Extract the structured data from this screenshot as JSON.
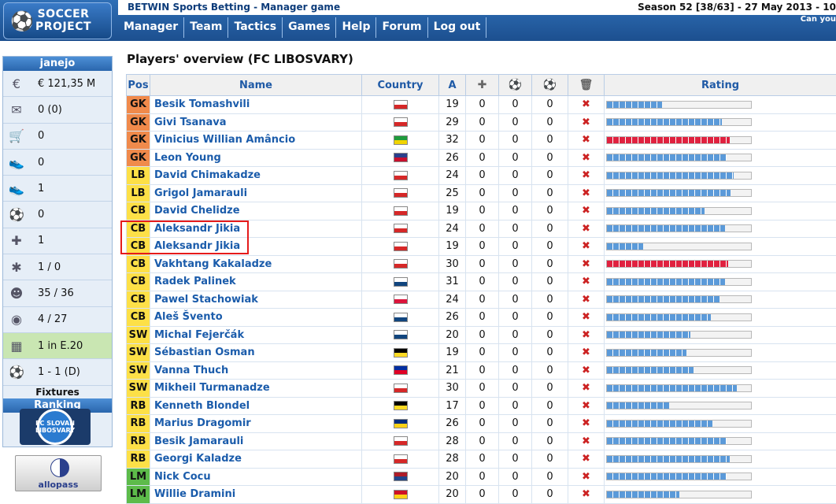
{
  "header": {
    "logo_line1": "SOCCER",
    "logo_line2": "PROJECT",
    "betwin": "BETWIN Sports Betting - Manager game",
    "season": "Season 52 [38/63] - 27 May 2013 - 10",
    "can_you": "Can you"
  },
  "nav": [
    "Manager",
    "Team",
    "Tactics",
    "Games",
    "Help",
    "Forum",
    "Log out"
  ],
  "sidebar": {
    "username": "janejo",
    "items": [
      {
        "icon": "money-icon",
        "value": "€ 121,35 M"
      },
      {
        "icon": "mail-icon",
        "value": "0 (0)"
      },
      {
        "icon": "cart-icon",
        "value": "0"
      },
      {
        "icon": "shoes-icon",
        "value": "0"
      },
      {
        "icon": "shoe-icon",
        "value": "1"
      },
      {
        "icon": "shoe-ball-icon",
        "value": "0"
      },
      {
        "icon": "medical-cross-icon",
        "value": "1"
      },
      {
        "icon": "injury-icon",
        "value": "1 / 0"
      },
      {
        "icon": "players-icon",
        "value": "35 / 36"
      },
      {
        "icon": "whistle-icon",
        "value": "4 / 27"
      },
      {
        "icon": "stadium-icon",
        "value": "1 in E.20"
      },
      {
        "icon": "ball-icon",
        "value": "1 - 1 (D)"
      }
    ],
    "fixtures": "Fixtures",
    "ranking": "Ranking",
    "crest_text": "FC SLOVAN LIBOSVARY",
    "allopass": "allopass"
  },
  "main": {
    "title": "Players' overview (FC LIBOSVARY)",
    "columns": [
      "Pos",
      "Name",
      "Country",
      "A",
      "",
      "",
      "",
      "",
      "Rating"
    ],
    "colors": {
      "GK": "#f08a4b",
      "LB": "#fde047",
      "CB": "#fde047",
      "SW": "#fde047",
      "RB": "#fde047",
      "LM": "#5dbb4a"
    },
    "players": [
      {
        "pos": "GK",
        "name": "Besik Tomashvili",
        "flag": "#ffffff",
        "flag2": "#d62828",
        "age": "19",
        "c1": "0",
        "c2": "0",
        "c3": "0",
        "rating": 0.38,
        "red": false
      },
      {
        "pos": "GK",
        "name": "Givi Tsanava",
        "flag": "#ffffff",
        "flag2": "#d62828",
        "age": "29",
        "c1": "0",
        "c2": "0",
        "c3": "0",
        "rating": 0.8,
        "red": false
      },
      {
        "pos": "GK",
        "name": "Vinicius Willian Amâncio",
        "flag": "#1e9b3c",
        "flag2": "#f1d400",
        "age": "32",
        "c1": "0",
        "c2": "0",
        "c3": "0",
        "rating": 0.85,
        "red": true
      },
      {
        "pos": "GK",
        "name": "Leon Young",
        "flag": "#2a3f8c",
        "flag2": "#c8102e",
        "age": "26",
        "c1": "0",
        "c2": "0",
        "c3": "0",
        "rating": 0.83,
        "red": false
      },
      {
        "pos": "LB",
        "name": "David Chimakadze",
        "flag": "#ffffff",
        "flag2": "#d62828",
        "age": "24",
        "c1": "0",
        "c2": "0",
        "c3": "0",
        "rating": 0.88,
        "red": false
      },
      {
        "pos": "LB",
        "name": "Grigol Jamarauli",
        "flag": "#ffffff",
        "flag2": "#d62828",
        "age": "25",
        "c1": "0",
        "c2": "0",
        "c3": "0",
        "rating": 0.86,
        "red": false
      },
      {
        "pos": "CB",
        "name": "David Chelidze",
        "flag": "#ffffff",
        "flag2": "#d62828",
        "age": "19",
        "c1": "0",
        "c2": "0",
        "c3": "0",
        "rating": 0.68,
        "red": false
      },
      {
        "pos": "CB",
        "name": "Aleksandr Jikia",
        "flag": "#ffffff",
        "flag2": "#d62828",
        "age": "24",
        "c1": "0",
        "c2": "0",
        "c3": "0",
        "rating": 0.82,
        "red": false
      },
      {
        "pos": "CB",
        "name": "Aleksandr Jikia",
        "flag": "#ffffff",
        "flag2": "#d62828",
        "age": "19",
        "c1": "0",
        "c2": "0",
        "c3": "0",
        "rating": 0.25,
        "red": false
      },
      {
        "pos": "CB",
        "name": "Vakhtang Kakaladze",
        "flag": "#ffffff",
        "flag2": "#d62828",
        "age": "30",
        "c1": "0",
        "c2": "0",
        "c3": "0",
        "rating": 0.84,
        "red": true
      },
      {
        "pos": "CB",
        "name": "Radek Palinek",
        "flag": "#ffffff",
        "flag2": "#11457e",
        "age": "31",
        "c1": "0",
        "c2": "0",
        "c3": "0",
        "rating": 0.82,
        "red": false
      },
      {
        "pos": "CB",
        "name": "Pawel Stachowiak",
        "flag": "#ffffff",
        "flag2": "#dc143c",
        "age": "24",
        "c1": "0",
        "c2": "0",
        "c3": "0",
        "rating": 0.78,
        "red": false
      },
      {
        "pos": "CB",
        "name": "Aleš Švento",
        "flag": "#ffffff",
        "flag2": "#11457e",
        "age": "26",
        "c1": "0",
        "c2": "0",
        "c3": "0",
        "rating": 0.72,
        "red": false
      },
      {
        "pos": "SW",
        "name": "Michal Fejerčák",
        "flag": "#ffffff",
        "flag2": "#11457e",
        "age": "20",
        "c1": "0",
        "c2": "0",
        "c3": "0",
        "rating": 0.58,
        "red": false
      },
      {
        "pos": "SW",
        "name": "Sébastian Osman",
        "flag": "#000000",
        "flag2": "#fdda24",
        "age": "19",
        "c1": "0",
        "c2": "0",
        "c3": "0",
        "rating": 0.55,
        "red": false
      },
      {
        "pos": "SW",
        "name": "Vanna Thuch",
        "flag": "#032ea1",
        "flag2": "#e00025",
        "age": "21",
        "c1": "0",
        "c2": "0",
        "c3": "0",
        "rating": 0.6,
        "red": false
      },
      {
        "pos": "SW",
        "name": "Mikheil Turmanadze",
        "flag": "#ffffff",
        "flag2": "#d62828",
        "age": "30",
        "c1": "0",
        "c2": "0",
        "c3": "0",
        "rating": 0.9,
        "red": false
      },
      {
        "pos": "RB",
        "name": "Kenneth Blondel",
        "flag": "#000000",
        "flag2": "#fdda24",
        "age": "17",
        "c1": "0",
        "c2": "0",
        "c3": "0",
        "rating": 0.43,
        "red": false
      },
      {
        "pos": "RB",
        "name": "Marius Dragomir",
        "flag": "#002b7f",
        "flag2": "#fcd116",
        "age": "26",
        "c1": "0",
        "c2": "0",
        "c3": "0",
        "rating": 0.73,
        "red": false
      },
      {
        "pos": "RB",
        "name": "Besik Jamarauli",
        "flag": "#ffffff",
        "flag2": "#d62828",
        "age": "28",
        "c1": "0",
        "c2": "0",
        "c3": "0",
        "rating": 0.83,
        "red": false
      },
      {
        "pos": "RB",
        "name": "Georgi Kaladze",
        "flag": "#ffffff",
        "flag2": "#d62828",
        "age": "28",
        "c1": "0",
        "c2": "0",
        "c3": "0",
        "rating": 0.85,
        "red": false
      },
      {
        "pos": "LM",
        "name": "Nick Cocu",
        "flag": "#ae1c28",
        "flag2": "#21468b",
        "age": "20",
        "c1": "0",
        "c2": "0",
        "c3": "0",
        "rating": 0.83,
        "red": false
      },
      {
        "pos": "LM",
        "name": "Willie Dramini",
        "flag": "#ce1126",
        "flag2": "#fcd116",
        "age": "20",
        "c1": "0",
        "c2": "0",
        "c3": "0",
        "rating": 0.5,
        "red": false
      }
    ]
  }
}
